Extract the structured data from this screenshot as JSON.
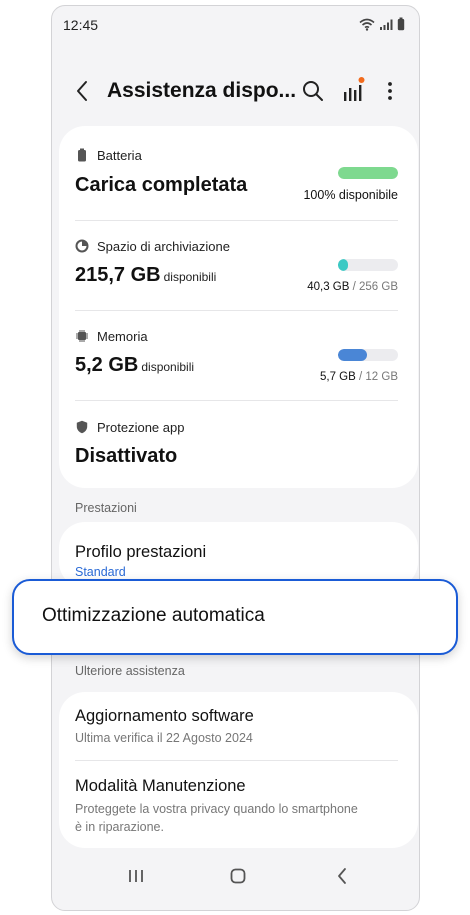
{
  "status_bar": {
    "time": "12:45"
  },
  "app_bar": {
    "title": "Assistenza dispo..."
  },
  "battery": {
    "label": "Batteria",
    "status": "Carica completata",
    "available": "100% disponibile",
    "level": 1.0
  },
  "storage": {
    "label": "Spazio di archiviazione",
    "value": "215,7 GB",
    "unit": "disponibili",
    "used": "40,3 GB",
    "total": "/ 256 GB",
    "used_fraction": 0.157
  },
  "memory": {
    "label": "Memoria",
    "value": "5,2 GB",
    "unit": "disponibili",
    "used": "5,7 GB",
    "total": "/ 12 GB",
    "used_fraction": 0.475
  },
  "app_protection": {
    "label": "Protezione app",
    "status": "Disattivato"
  },
  "performance_section": {
    "header": "Prestazioni",
    "profile_title": "Profilo prestazioni",
    "profile_value": "Standard"
  },
  "auto_optimization": {
    "label": "Ottimizzazione automatica"
  },
  "more_section": {
    "header": "Ulteriore assistenza",
    "software_title": "Aggiornamento software",
    "software_sub": "Ultima verifica il 22 Agosto 2024",
    "maintenance_title": "Modalità Manutenzione",
    "maintenance_sub_1": "Proteggete la vostra privacy quando lo smartphone",
    "maintenance_sub_2": "è in riparazione."
  },
  "colors": {
    "accent": "#1a5bd6",
    "battery": "#7ed98f",
    "storage": "#3cc9c4",
    "memory": "#4a86d6",
    "notification_dot": "#f26b1d"
  },
  "icons": [
    "wifi-icon",
    "signal-icon",
    "battery-status-icon",
    "back-icon",
    "search-icon",
    "stats-icon",
    "more-icon",
    "battery-icon",
    "storage-icon",
    "memory-icon",
    "shield-icon",
    "recents-icon",
    "home-icon",
    "nav-back-icon"
  ]
}
